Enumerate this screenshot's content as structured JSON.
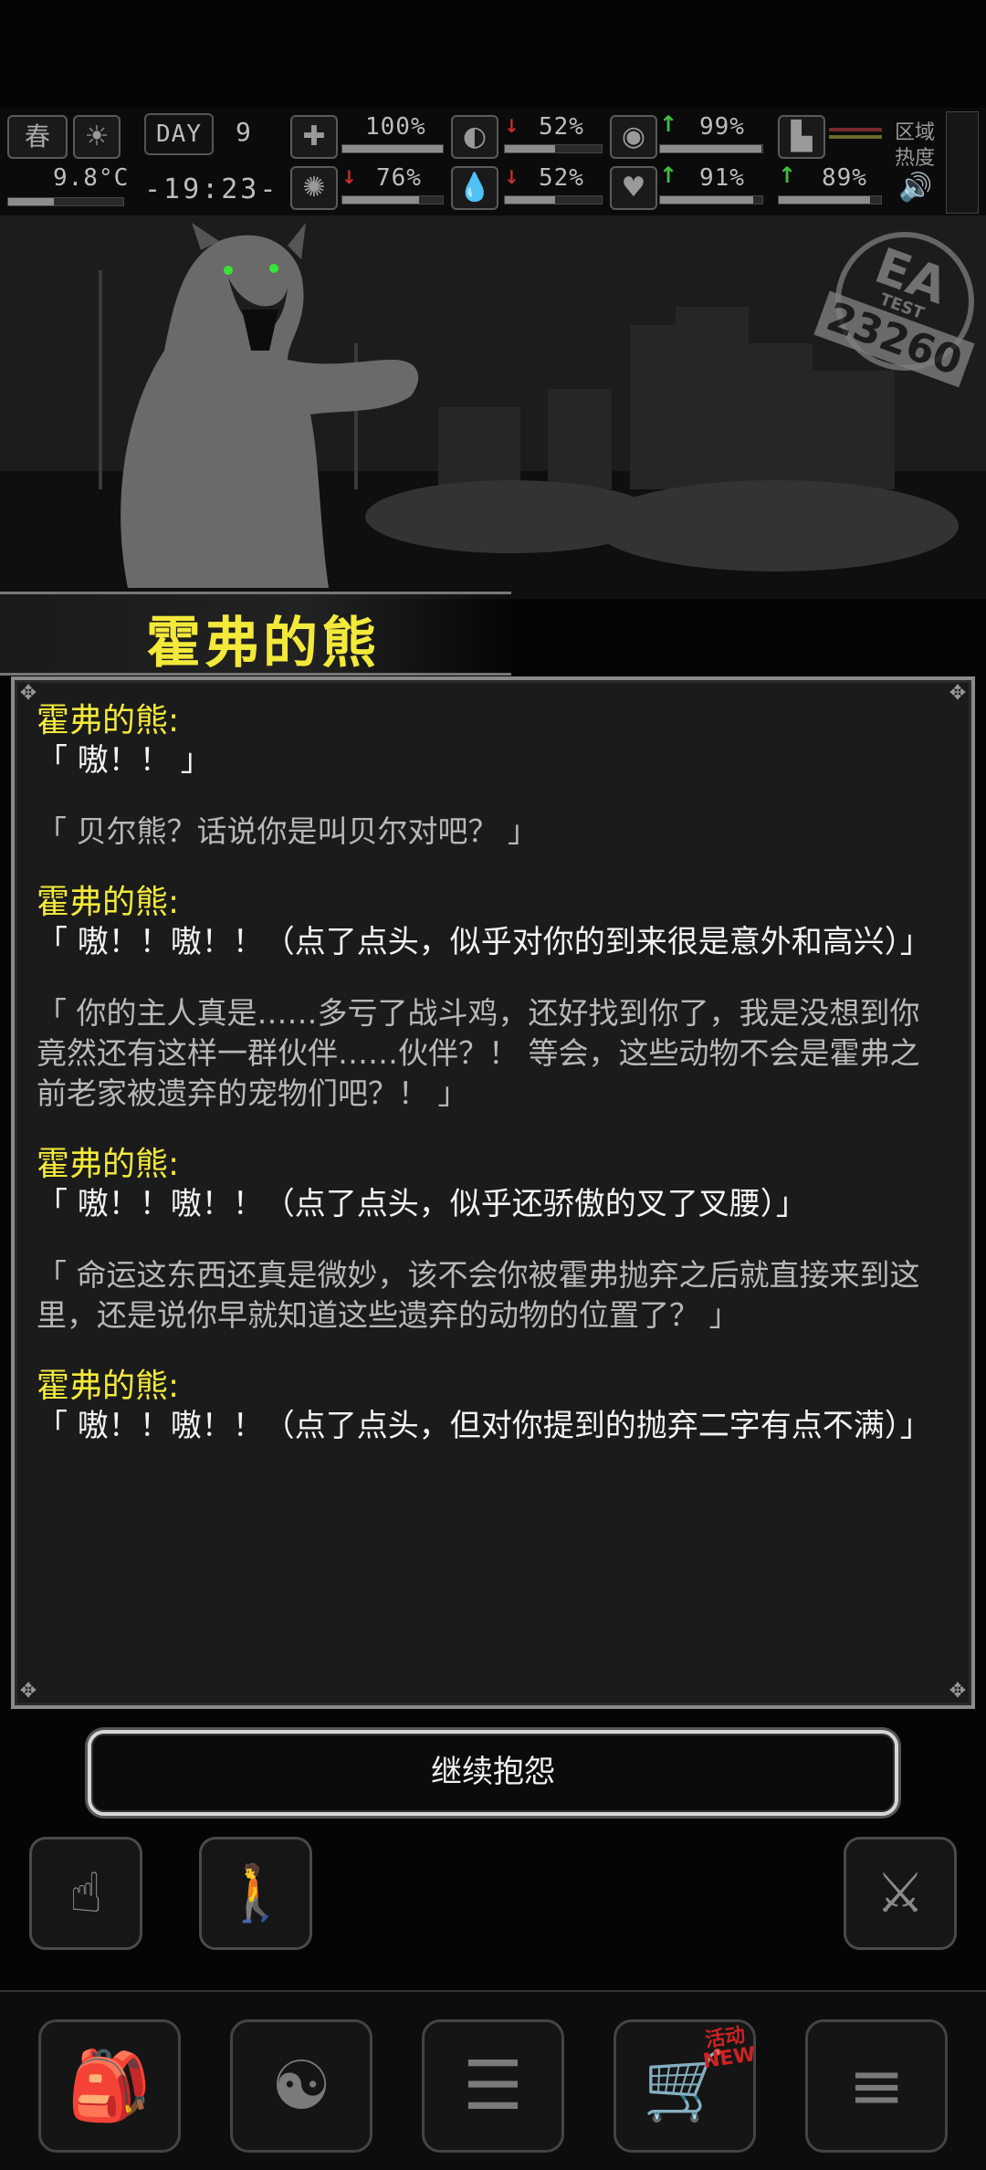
{
  "hud": {
    "season": "春",
    "temperature": "9.8°C",
    "day_label": "DAY",
    "day_number": "9",
    "clock": "-19:23-",
    "health": "100%",
    "health_level": 1.0,
    "stomach": "52%",
    "stomach_level": 0.52,
    "stamina": "99%",
    "stamina_level": 0.99,
    "sanity": "76%",
    "sanity_level": 0.76,
    "thirst": "52%",
    "thirst_level": 0.52,
    "heart": "91%",
    "heart_level": 0.91,
    "boots": "89%",
    "boots_level": 0.89,
    "region_heat_label": "区域\n热度"
  },
  "scene": {
    "watermark_top": "EA",
    "watermark_mid": "TEST",
    "watermark_num": "23260"
  },
  "event": {
    "title": "霍弗的熊"
  },
  "dialog": {
    "messages": [
      {
        "type": "bear",
        "speaker": "霍弗的熊:",
        "text": "「 嗷！！ 」"
      },
      {
        "type": "player",
        "text": "「 贝尔熊？话说你是叫贝尔对吧？ 」"
      },
      {
        "type": "bear",
        "speaker": "霍弗的熊:",
        "text": "「 嗷！！嗷！！（点了点头，似乎对你的到来很是意外和高兴）」"
      },
      {
        "type": "player",
        "text": "「 你的主人真是……多亏了战斗鸡，还好找到你了，我是没想到你竟然还有这样一群伙伴……伙伴？！ 等会，这些动物不会是霍弗之前老家被遗弃的宠物们吧？！ 」"
      },
      {
        "type": "bear",
        "speaker": "霍弗的熊:",
        "text": "「 嗷！！嗷！！（点了点头，似乎还骄傲的叉了叉腰）」"
      },
      {
        "type": "player",
        "text": "「 命运这东西还真是微妙，该不会你被霍弗抛弃之后就直接来到这里，还是说你早就知道这些遗弃的动物的位置了？ 」"
      },
      {
        "type": "bear",
        "speaker": "霍弗的熊:",
        "text": "「 嗷！！嗷！！（点了点头，但对你提到的抛弃二字有点不满）」"
      }
    ]
  },
  "continue_button": {
    "label": "继续抱怨"
  },
  "bottom_nav": {
    "shop_badge_top": "活动",
    "shop_badge_bottom": "NEW"
  },
  "colors": {
    "speaker": "#f2e93a",
    "bear_text": "#f4f4f4",
    "player_text": "#b8b8b8",
    "up_arrow": "#3fbf3f",
    "down_arrow": "#c23030"
  }
}
